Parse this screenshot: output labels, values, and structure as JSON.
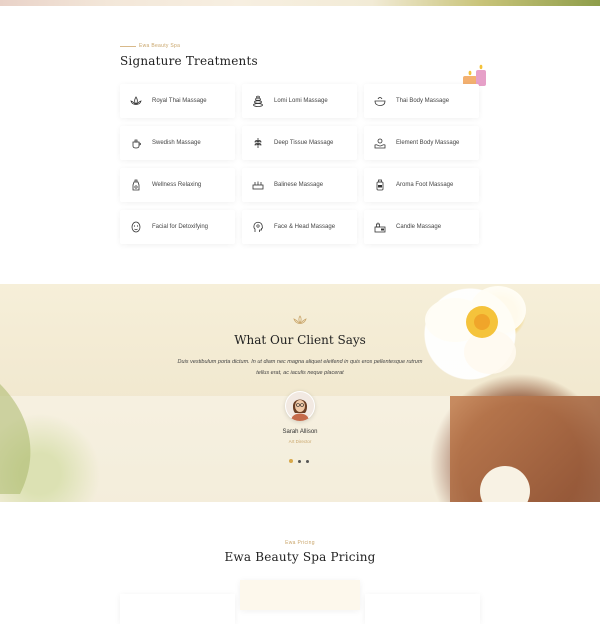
{
  "treatments": {
    "eyebrow": "Ewa Beauty Spa",
    "title": "Signature Treatments",
    "items": [
      {
        "label": "Royal Thai Massage",
        "icon": "lotus-icon"
      },
      {
        "label": "Lomi Lomi Massage",
        "icon": "stones-icon"
      },
      {
        "label": "Thai Body Massage",
        "icon": "bowl-icon"
      },
      {
        "label": "Swedish Massage",
        "icon": "teapot-icon"
      },
      {
        "label": "Deep Tissue Massage",
        "icon": "herb-icon"
      },
      {
        "label": "Element Body Massage",
        "icon": "hands-icon"
      },
      {
        "label": "Wellness Relaxing",
        "icon": "oil-bottle-icon"
      },
      {
        "label": "Balinese Massage",
        "icon": "candles-icon"
      },
      {
        "label": "Aroma Foot Massage",
        "icon": "jar-icon"
      },
      {
        "label": "Facial for Detoxifying",
        "icon": "face-mask-icon"
      },
      {
        "label": "Face & Head Massage",
        "icon": "head-icon"
      },
      {
        "label": "Candle Massage",
        "icon": "candle-set-icon"
      }
    ]
  },
  "testimonial": {
    "title": "What Our Client Says",
    "quote": "Duis vestibulum porta dictum. In ut diam nec magna aliquet eleifend in quis eros pellentesque rutrum tellus erat, ac iaculis neque placerat",
    "name": "Sarah Allison",
    "role": "Art Director",
    "dots": 3,
    "active_dot": 0
  },
  "pricing": {
    "eyebrow": "Ewa Pricing",
    "title": "Ewa Beauty Spa Pricing"
  },
  "colors": {
    "accent": "#c9a56a",
    "text": "#222222"
  }
}
